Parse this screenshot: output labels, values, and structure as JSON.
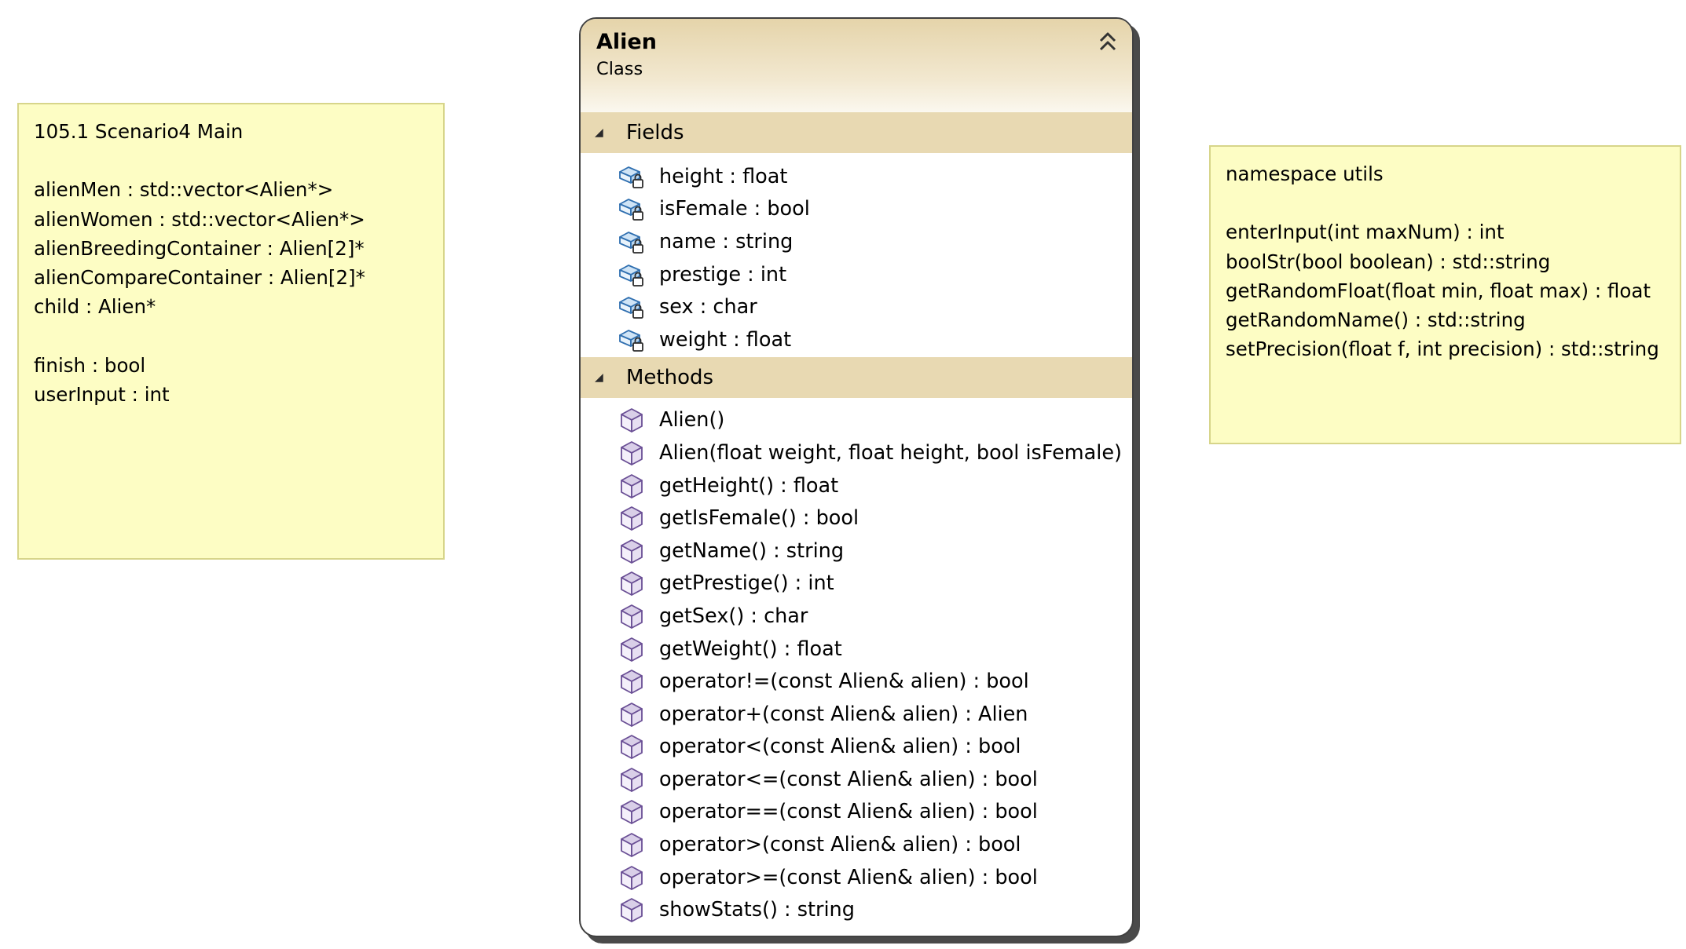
{
  "left_note": {
    "lines": [
      "105.1 Scenario4 Main",
      "",
      "alienMen : std::vector<Alien*>",
      "alienWomen : std::vector<Alien*>",
      "alienBreedingContainer : Alien[2]*",
      "alienCompareContainer : Alien[2]*",
      "child : Alien*",
      "",
      "finish : bool",
      "userInput : int"
    ]
  },
  "right_note": {
    "lines": [
      "namespace utils",
      "",
      "enterInput(int maxNum) : int",
      "boolStr(bool boolean) : std::string",
      "getRandomFloat(float min, float max) : float",
      "getRandomName() : std::string",
      "setPrecision(float f, int precision) : std::string"
    ]
  },
  "class_box": {
    "name": "Alien",
    "kind": "Class",
    "collapse_icon": "double-chevron-up-icon",
    "fields_label": "Fields",
    "methods_label": "Methods",
    "field_icon": "private-field-icon",
    "method_icon": "method-cube-icon",
    "fields": [
      "height : float",
      "isFemale : bool",
      "name : string",
      "prestige : int",
      "sex : char",
      "weight : float"
    ],
    "methods": [
      "Alien()",
      "Alien(float weight, float height, bool isFemale)",
      "getHeight() : float",
      "getIsFemale() : bool",
      "getName() : string",
      "getPrestige() : int",
      "getSex() : char",
      "getWeight() : float",
      "operator!=(const Alien& alien) : bool",
      "operator+(const Alien& alien) : Alien",
      "operator<(const Alien& alien) : bool",
      "operator<=(const Alien& alien) : bool",
      "operator==(const Alien& alien) : bool",
      "operator>(const Alien& alien) : bool",
      "operator>=(const Alien& alien) : bool",
      "showStats() : string"
    ]
  }
}
